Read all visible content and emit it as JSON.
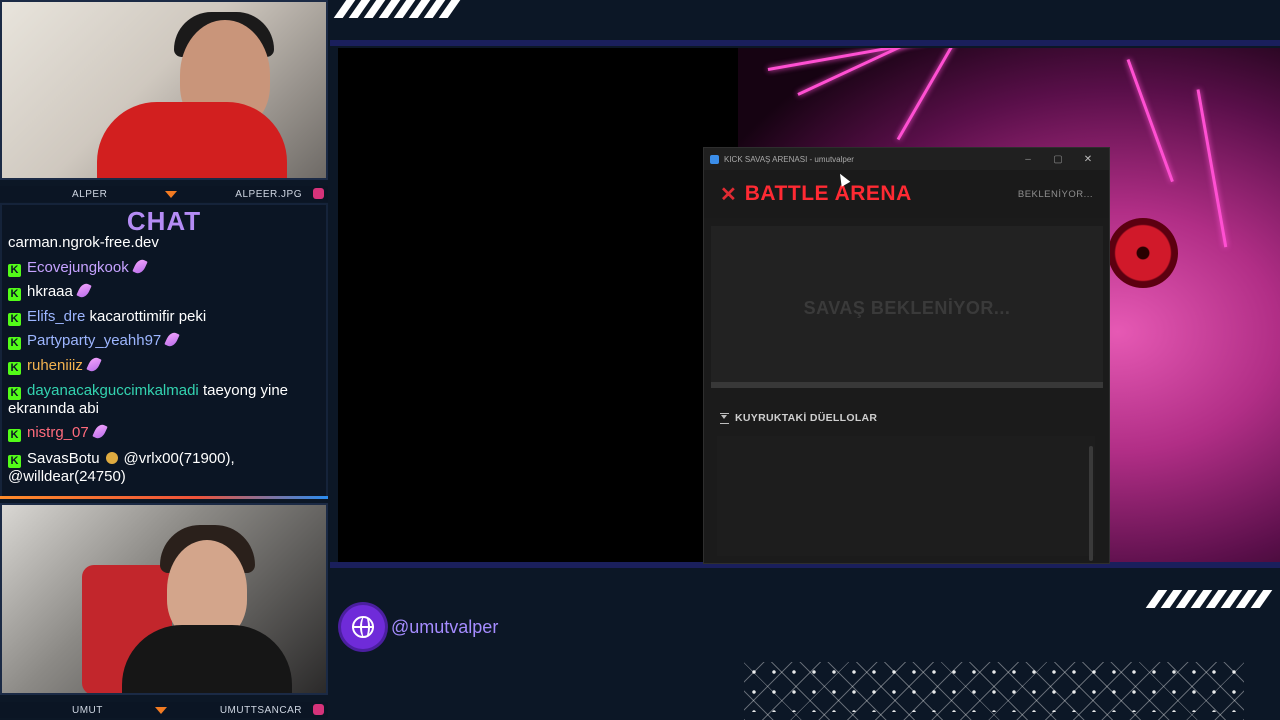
{
  "webcams": {
    "top": {
      "left_label": "ALPER",
      "right_label": "ALPEER.JPG"
    },
    "bottom": {
      "left_label": "UMUT",
      "right_label": "UMUTTSANCAR"
    }
  },
  "chat": {
    "title": "CHAT",
    "lines": [
      {
        "user": "",
        "message": "carman.ngrok-free.dev",
        "has_badge": false,
        "feather": false,
        "coin": false,
        "color": "white"
      },
      {
        "user": "Ecovejungkook",
        "message": "",
        "has_badge": true,
        "feather": true,
        "coin": false,
        "color": "violet"
      },
      {
        "user": "hkraaa",
        "message": "",
        "has_badge": true,
        "feather": true,
        "coin": false,
        "color": "white"
      },
      {
        "user": "Elifs_dre",
        "message": "kacarottimifir peki",
        "has_badge": true,
        "feather": false,
        "coin": false,
        "color": "blue"
      },
      {
        "user": "Partyparty_yeahh97",
        "message": "",
        "has_badge": true,
        "feather": true,
        "coin": false,
        "color": "blue"
      },
      {
        "user": "ruheniiiz",
        "message": "",
        "has_badge": true,
        "feather": true,
        "coin": false,
        "color": "orange"
      },
      {
        "user": "dayanacakguccimkalmadi",
        "message": "taeyong yine ekranında abi",
        "has_badge": true,
        "feather": false,
        "coin": false,
        "color": "teal"
      },
      {
        "user": "nistrg_07",
        "message": "",
        "has_badge": true,
        "feather": true,
        "coin": false,
        "color": "red"
      },
      {
        "user": "SavasBotu",
        "message": "@vrlx00(71900), @willdear(24750)",
        "has_badge": true,
        "feather": false,
        "coin": true,
        "color": "white"
      }
    ]
  },
  "app_window": {
    "title": "KICK SAVAŞ ARENASI - umutvalper",
    "controls": [
      "–",
      "▢",
      "✕"
    ],
    "header_title": "BATTLE ARENA",
    "header_status": "BEKLENİYOR...",
    "battle_text": "SAVAŞ BEKLENİYOR...",
    "queue_title": "KUYRUKTAKİ DÜELLOLAR"
  },
  "social": {
    "handle": "@umutvalper"
  },
  "colors": {
    "accent_red": "#ff2a33",
    "kick_green": "#53fc18",
    "chat_title": "#b58cf5",
    "handle": "#a58cff"
  }
}
